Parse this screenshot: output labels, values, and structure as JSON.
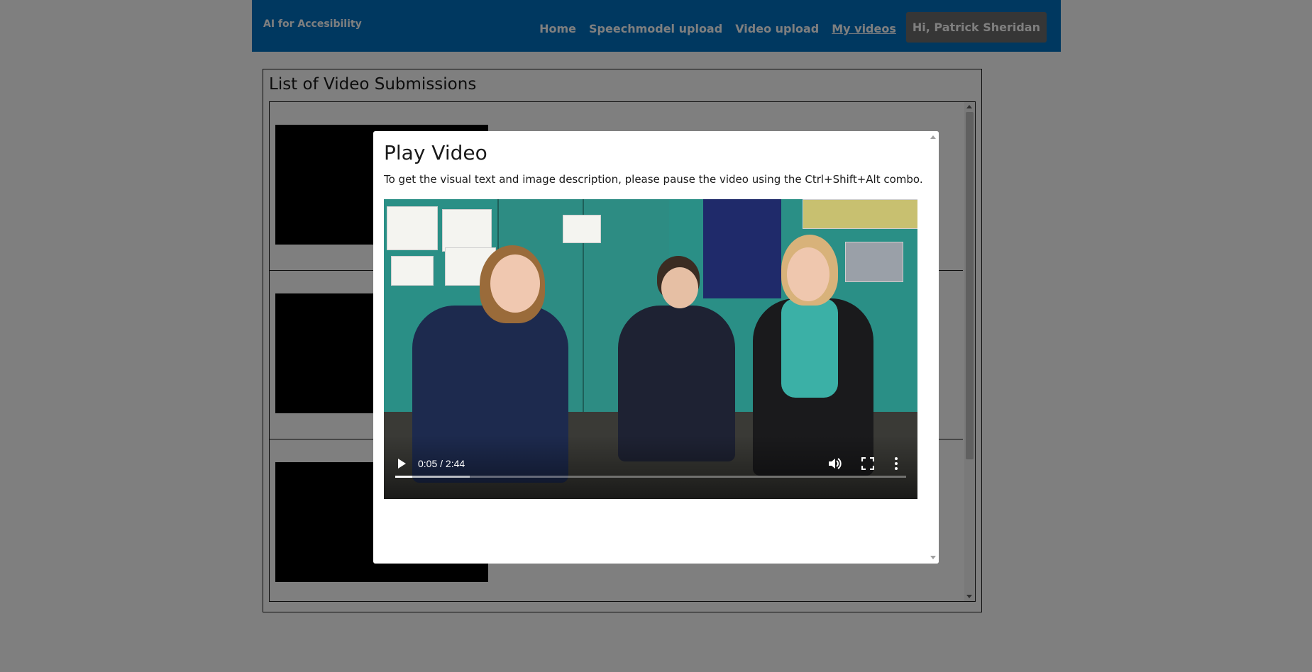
{
  "navbar": {
    "brand": "AI for Accesibility",
    "links": [
      {
        "label": "Home",
        "active": false
      },
      {
        "label": "Speechmodel upload",
        "active": false
      },
      {
        "label": "Video upload",
        "active": false
      },
      {
        "label": "My videos",
        "active": true
      }
    ],
    "user_greeting": "Hi, Patrick Sheridan"
  },
  "main": {
    "title": "List of Video Submissions"
  },
  "modal": {
    "title": "Play Video",
    "description": "To get the visual text and image description, please pause the video using the Ctrl+Shift+Alt combo.",
    "player": {
      "current_time": "0:05",
      "duration": "2:44",
      "time_display": "0:05 / 2:44",
      "progress_fraction": 0.034,
      "buffered_fraction": 0.146,
      "state": "paused",
      "icons": [
        "play-icon",
        "volume-icon",
        "fullscreen-icon",
        "more-options-icon"
      ]
    }
  }
}
